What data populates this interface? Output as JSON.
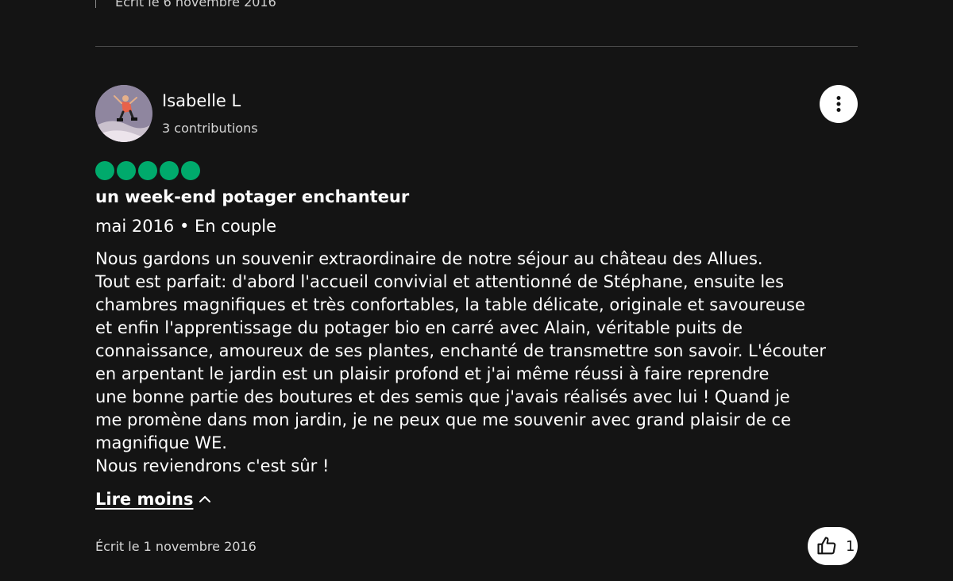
{
  "previous_review": {
    "written_date": "Écrit le 6 novembre 2016"
  },
  "review": {
    "user": {
      "name": "Isabelle L",
      "contributions": "3 contributions"
    },
    "rating": 5,
    "rating_color": "#00aa6c",
    "title": "un week-end potager enchanteur",
    "trip_meta": "mai 2016 • En couple",
    "body_lines": [
      "Nous gardons un souvenir extraordinaire de notre séjour au château des Allues.",
      "Tout est parfait: d'abord l'accueil convivial et attentionné de Stéphane, ensuite les",
      "chambres magnifiques et très confortables, la table délicate, originale et savoureuse",
      "et enfin l'apprentissage du potager bio en carré avec Alain, véritable puits de",
      "connaissance, amoureux de ses plantes, enchanté de transmettre son savoir. L'écouter",
      "en arpentant le jardin est un plaisir profond et j'ai même réussi à faire reprendre",
      "une bonne partie des boutures et des semis que j'avais réalisés avec lui ! Quand je",
      "me promène dans mon jardin, je ne peux que me souvenir avec grand plaisir de ce",
      "magnifique WE.",
      "Nous reviendrons c'est sûr !"
    ],
    "read_less_label": "Lire moins",
    "written_date": "Écrit le 1 novembre 2016",
    "helpful_count": "1",
    "icons": {
      "more": "more-vertical-icon",
      "read_less": "chevron-up-icon",
      "helpful": "thumbs-up-icon"
    }
  }
}
